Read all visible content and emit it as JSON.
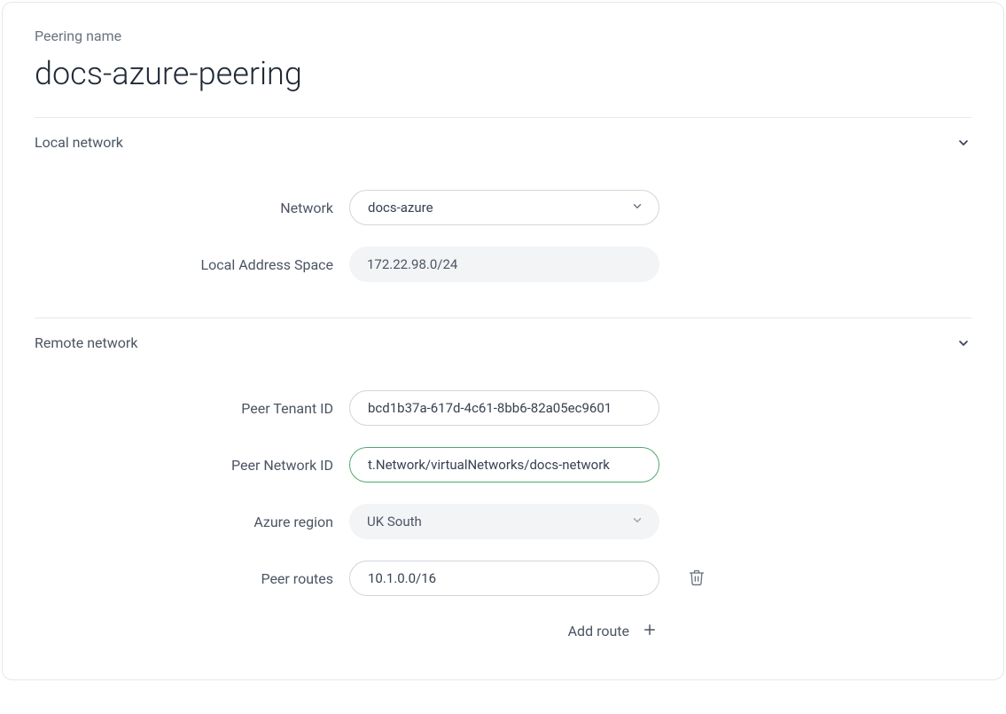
{
  "peering_name": {
    "label": "Peering name",
    "value": "docs-azure-peering"
  },
  "local_network": {
    "title": "Local network",
    "network": {
      "label": "Network",
      "value": "docs-azure"
    },
    "address_space": {
      "label": "Local Address Space",
      "value": "172.22.98.0/24"
    }
  },
  "remote_network": {
    "title": "Remote network",
    "peer_tenant_id": {
      "label": "Peer Tenant ID",
      "value": "bcd1b37a-617d-4c61-8bb6-82a05ec9601"
    },
    "peer_network_id": {
      "label": "Peer Network ID",
      "value": "t.Network/virtualNetworks/docs-network"
    },
    "azure_region": {
      "label": "Azure region",
      "value": "UK South"
    },
    "peer_routes": {
      "label": "Peer routes",
      "routes": [
        "10.1.0.0/16"
      ]
    },
    "add_route_label": "Add route"
  }
}
